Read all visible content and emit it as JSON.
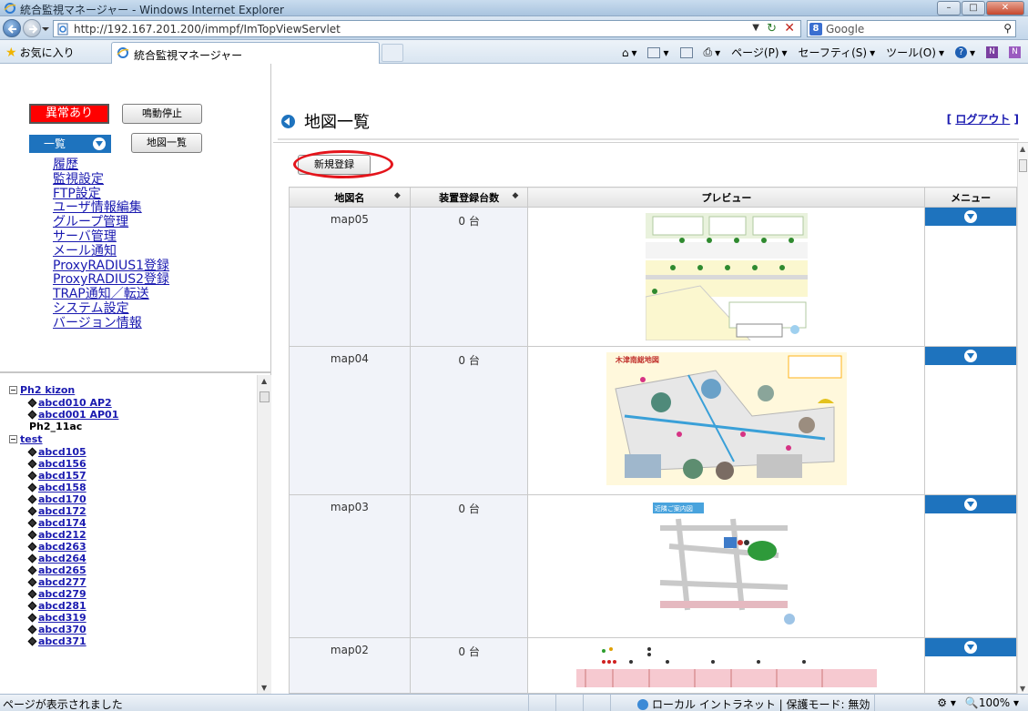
{
  "window": {
    "title": "統合監視マネージャー - Windows Internet Explorer",
    "url": "http://192.167.201.200/immpf/ImTopViewServlet",
    "search_provider": "Google",
    "favorites_label": "お気に入り",
    "tab_title": "統合監視マネージャー",
    "commands": [
      "ページ(P)",
      "セーフティ(S)",
      "ツール(O)"
    ],
    "status_text": "ページが表示されました",
    "zone_text": "ローカル イントラネット | 保護モード: 無効",
    "zoom": "100%"
  },
  "left": {
    "alert_button": "異常あり",
    "mute_button": "鳴動停止",
    "list_dropdown": "一覧",
    "maplist_button": "地図一覧",
    "menu_links": [
      "履歴",
      "監視設定",
      "FTP設定",
      "ユーザ情報編集",
      "グループ管理",
      "サーバ管理",
      "メール通知",
      "ProxyRADIUS1登録",
      "ProxyRADIUS2登録",
      "TRAP通知／転送",
      "システム設定",
      "バージョン情報"
    ],
    "tree": {
      "group1": "Ph2 kizon",
      "group1_items": [
        "abcd010 AP2",
        "abcd001 AP01"
      ],
      "plain": "Ph2_11ac",
      "group2": "test",
      "group2_items": [
        "abcd105",
        "abcd156",
        "abcd157",
        "abcd158",
        "abcd170",
        "abcd172",
        "abcd174",
        "abcd212",
        "abcd263",
        "abcd264",
        "abcd265",
        "abcd277",
        "abcd279",
        "abcd281",
        "abcd319",
        "abcd370",
        "abcd371"
      ]
    }
  },
  "main": {
    "title": "地図一覧",
    "logout_prefix": "[",
    "logout": "ログアウト",
    "logout_suffix": "]",
    "new_button": "新規登録",
    "columns": [
      "地図名",
      "装置登録台数",
      "プレビュー",
      "メニュー"
    ],
    "rows": [
      {
        "name": "map05",
        "count": "0 台"
      },
      {
        "name": "map04",
        "count": "0 台"
      },
      {
        "name": "map03",
        "count": "0 台"
      },
      {
        "name": "map02",
        "count": "0 台"
      }
    ],
    "map04_title": "木津南総地図",
    "map03_title": "近隣ご案内図"
  },
  "colors": {
    "accent_blue": "#1e73be",
    "alert_red": "#ff0000",
    "link_blue": "#1a1ab0",
    "highlight_red": "#e4141b"
  }
}
